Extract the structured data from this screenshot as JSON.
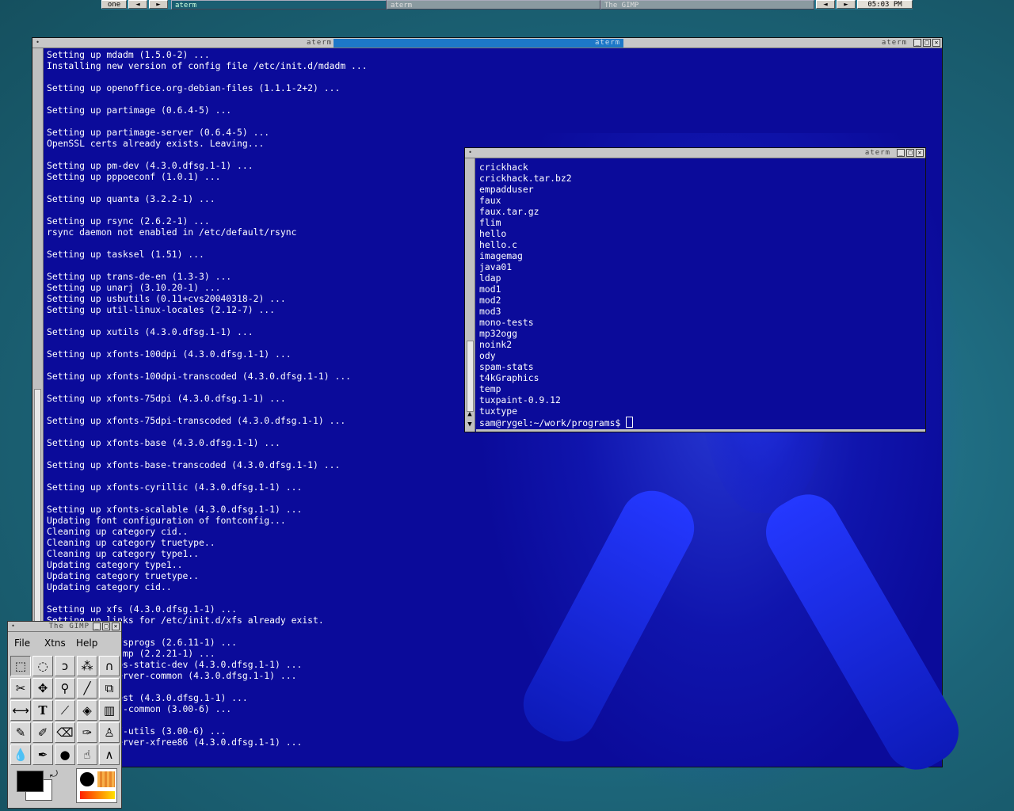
{
  "panel": {
    "desktop_label": "one",
    "prev_arrow": "◄",
    "next_arrow": "►",
    "tasks": [
      "aterm",
      "aterm",
      "The GIMP"
    ],
    "clock": "05:03 PM"
  },
  "main_terminal": {
    "titles": [
      "aterm",
      "aterm",
      "aterm"
    ],
    "lines": [
      "Setting up mdadm (1.5.0-2) ...",
      "Installing new version of config file /etc/init.d/mdadm ...",
      "",
      "Setting up openoffice.org-debian-files (1.1.1-2+2) ...",
      "",
      "Setting up partimage (0.6.4-5) ...",
      "",
      "Setting up partimage-server (0.6.4-5) ...",
      "OpenSSL certs already exists. Leaving...",
      "",
      "Setting up pm-dev (4.3.0.dfsg.1-1) ...",
      "Setting up pppoeconf (1.0.1) ...",
      "",
      "Setting up quanta (3.2.2-1) ...",
      "",
      "Setting up rsync (2.6.2-1) ...",
      "rsync daemon not enabled in /etc/default/rsync",
      "",
      "Setting up tasksel (1.51) ...",
      "",
      "Setting up trans-de-en (1.3-3) ...",
      "Setting up unarj (3.10.20-1) ...",
      "Setting up usbutils (0.11+cvs20040318-2) ...",
      "Setting up util-linux-locales (2.12-7) ...",
      "",
      "Setting up xutils (4.3.0.dfsg.1-1) ...",
      "",
      "Setting up xfonts-100dpi (4.3.0.dfsg.1-1) ...",
      "",
      "Setting up xfonts-100dpi-transcoded (4.3.0.dfsg.1-1) ...",
      "",
      "Setting up xfonts-75dpi (4.3.0.dfsg.1-1) ...",
      "",
      "Setting up xfonts-75dpi-transcoded (4.3.0.dfsg.1-1) ...",
      "",
      "Setting up xfonts-base (4.3.0.dfsg.1-1) ...",
      "",
      "Setting up xfonts-base-transcoded (4.3.0.dfsg.1-1) ...",
      "",
      "Setting up xfonts-cyrillic (4.3.0.dfsg.1-1) ...",
      "",
      "Setting up xfonts-scalable (4.3.0.dfsg.1-1) ...",
      "Updating font configuration of fontconfig...",
      "Cleaning up category cid..",
      "Cleaning up category truetype..",
      "Cleaning up category type1..",
      "Updating category type1..",
      "Updating category truetype..",
      "Updating category cid..",
      "",
      "Setting up xfs (4.3.0.dfsg.1-1) ...",
      "Setting up links for /etc/init.d/xfs already exist.",
      "",
      "Setting up e2fsprogs (2.6.11-1) ...",
      "Setting up xdump (2.2.21-1) ...",
      "Setting up libs-static-dev (4.3.0.dfsg.1-1) ...",
      "Setting up xserver-common (4.3.0.dfsg.1-1) ...",
      "",
      "Setting up xtest (4.3.0.dfsg.1-1) ...",
      "Setting up xdf-common (3.00-6) ...",
      "",
      "Setting up xdf-utils (3.00-6) ...",
      "Setting up xserver-xfree86 (4.3.0.dfsg.1-1) ..."
    ]
  },
  "small_terminal": {
    "title": "aterm",
    "lines": [
      "crickhack",
      "crickhack.tar.bz2",
      "empadduser",
      "faux",
      "faux.tar.gz",
      "flim",
      "hello",
      "hello.c",
      "imagemag",
      "java01",
      "ldap",
      "mod1",
      "mod2",
      "mod3",
      "mono-tests",
      "mp32ogg",
      "noink2",
      "ody",
      "spam-stats",
      "t4kGraphics",
      "temp",
      "tuxpaint-0.9.12",
      "tuxtype"
    ],
    "prompt": "sam@rygel:~/work/programs$ "
  },
  "gimp": {
    "title": "The GIMP",
    "menu": [
      "File",
      "Xtns",
      "Help"
    ]
  },
  "colors": {
    "terminal_bg": "#0b0b9a",
    "desktop_bg": "#1e6a80",
    "active_title": "#1d78c8"
  }
}
